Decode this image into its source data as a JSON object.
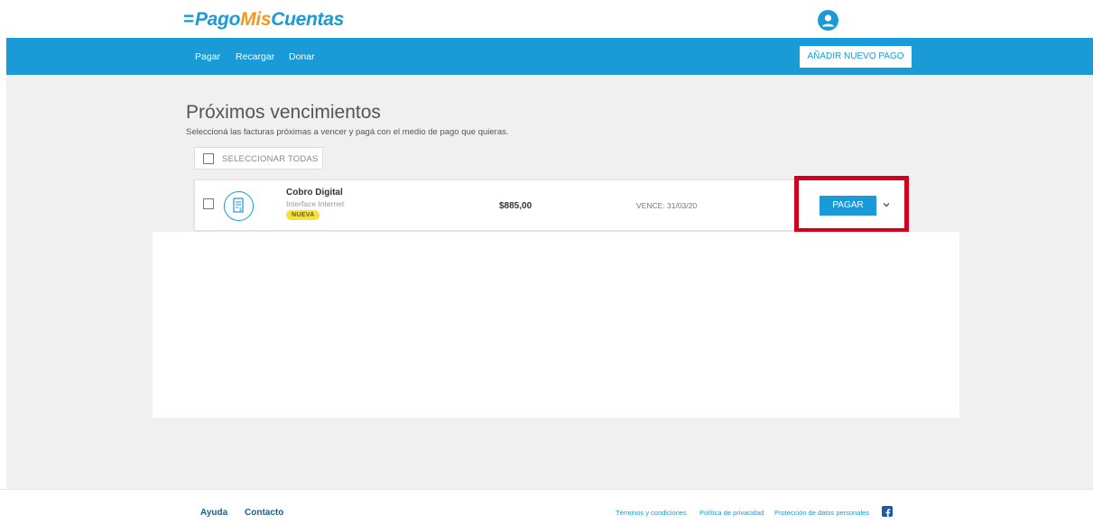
{
  "header": {
    "logo": {
      "part1": "Pago",
      "part2": "Mis",
      "part3": "Cuentas"
    },
    "avatar_icon": "user-icon"
  },
  "nav": {
    "items": [
      "Pagar",
      "Recargar",
      "Donar"
    ],
    "add_payment_label": "AÑADIR NUEVO PAGO"
  },
  "main": {
    "title": "Próximos vencimientos",
    "subtitle": "Seleccioná las facturas próximas a vencer y pagá con el medio de pago que quieras.",
    "select_all_label": "SELECCIONAR TODAS",
    "bills": [
      {
        "name": "Cobro Digital",
        "subtitle": "Interface Internet",
        "badge": "NUEVA",
        "amount": "$885,00",
        "due": "VENCE: 31/03/20",
        "pay_label": "PAGAR",
        "icon": "invoice-icon"
      }
    ]
  },
  "footer": {
    "links": [
      "Ayuda",
      "Contacto"
    ],
    "legal": [
      "Términos y condiciones",
      "Política de privacidad",
      "Protección de datos personales"
    ],
    "social_icon": "facebook-icon"
  },
  "colors": {
    "brand_blue": "#1a9ad6",
    "brand_orange": "#f39a1e",
    "highlight_red": "#d2001e",
    "badge_yellow": "#f5e23b"
  }
}
